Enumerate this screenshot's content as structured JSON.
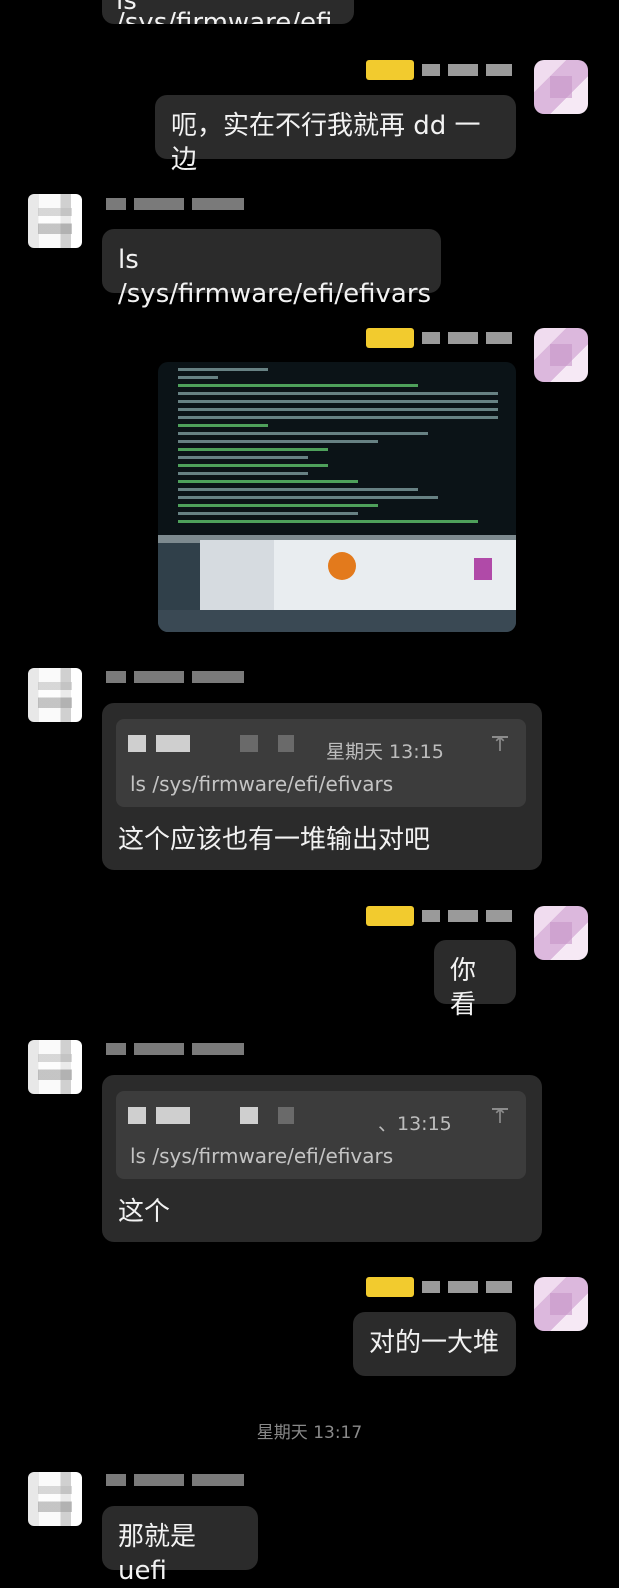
{
  "messages": {
    "top_clip_text": "ls /sys/firmware/efi",
    "m1_text": "呃，实在不行我就再 dd 一边",
    "m2_text": "ls /sys/firmware/efi/efivars",
    "m4_quote_time": "星期天 13:15",
    "m4_quote_text": "ls /sys/firmware/efi/efivars",
    "m4_text": "这个应该也有一堆输出对吧",
    "m5_text": "你看",
    "m6_quote_time": "、13:15",
    "m6_quote_text": "ls /sys/firmware/efi/efivars",
    "m6_text": "这个",
    "m7_text": "对的一大堆",
    "timestamp": "星期天 13:17",
    "m8_text": "那就是 uefi"
  },
  "colors": {
    "background": "#000000",
    "bubble": "#2b2b2b",
    "quote_bg": "#3c3c3c",
    "tag": "#f2cb2e"
  },
  "icons": {
    "quote_jump": "arrow-up-to-top-icon"
  }
}
